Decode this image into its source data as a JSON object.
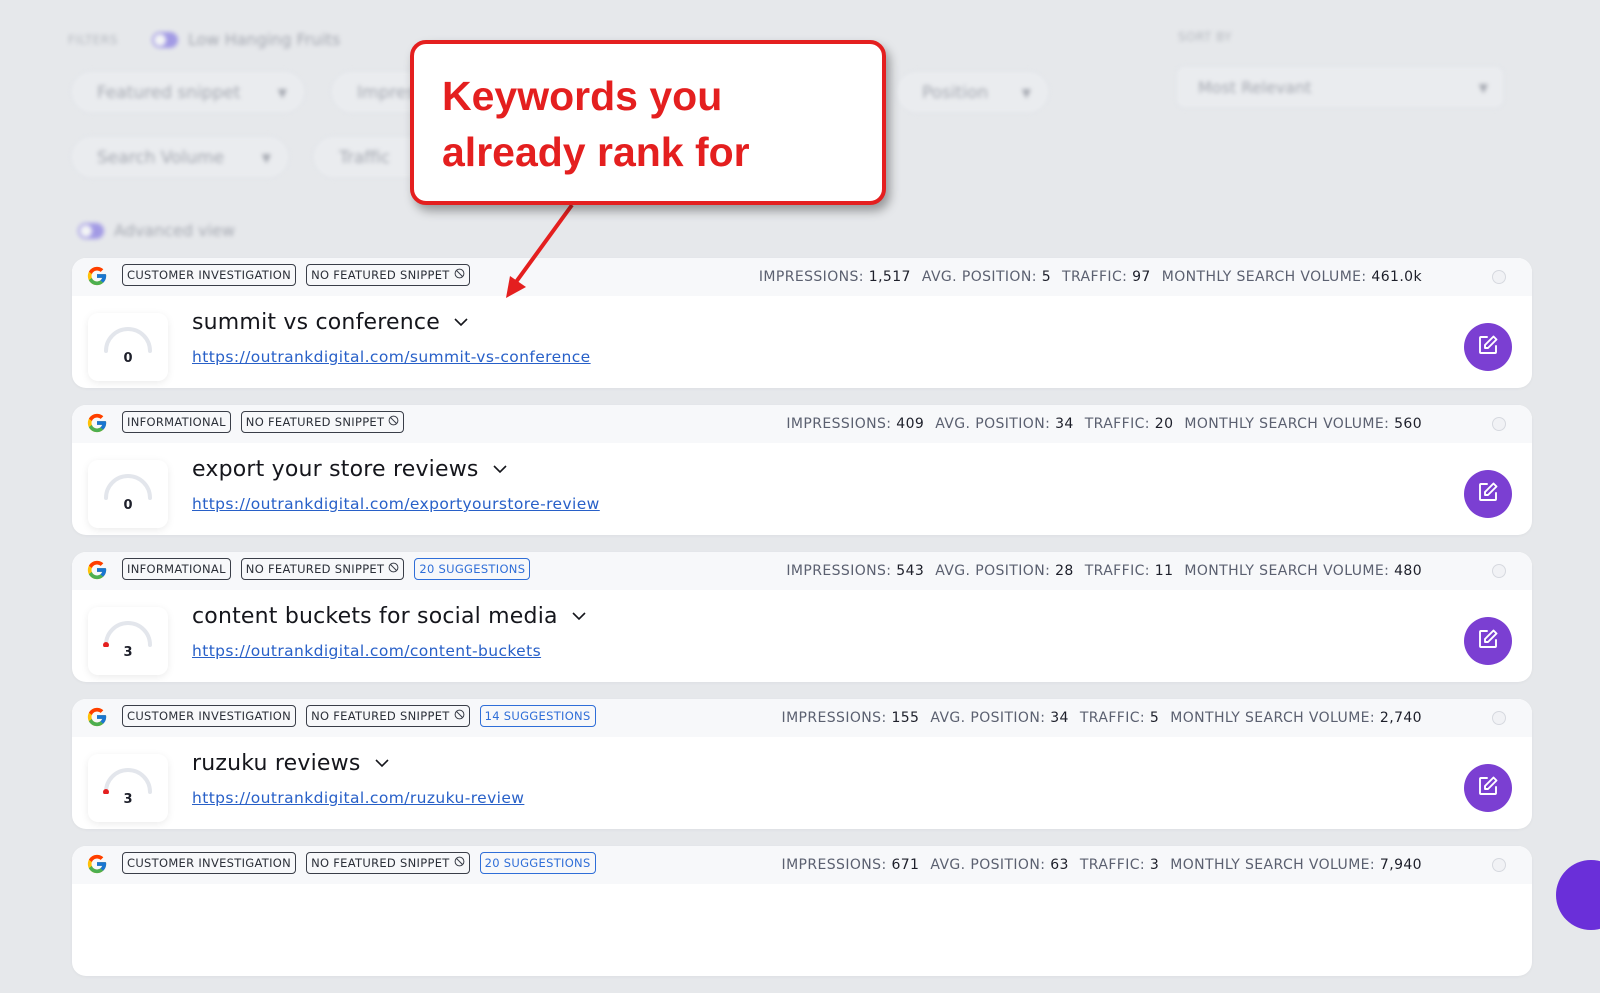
{
  "filters": {
    "filters_label": "FILTERS",
    "low_hanging_label": "Low Hanging Fruits",
    "pill_featured": "Featured snippet",
    "pill_impressions": "Impressions",
    "pill_position": "Position",
    "pill_search_volume": "Search Volume",
    "pill_traffic": "Traffic",
    "sort_label": "SORT BY",
    "sort_value": "Most Relevant",
    "advanced_view": "Advanced view"
  },
  "callout": {
    "text": "Keywords you already rank for"
  },
  "metric_labels": {
    "impressions": "IMPRESSIONS:",
    "avg_position": "AVG. POSITION:",
    "traffic": "TRAFFIC:",
    "monthly_search_volume": "MONTHLY SEARCH VOLUME:"
  },
  "no_snippet_label": "NO FEATURED SNIPPET",
  "colors": {
    "accent_purple": "#7b3fd2",
    "callout_red": "#e41f1f",
    "link_blue": "#2860c8",
    "suggestion_blue": "#2f6ed8"
  },
  "icons": {
    "engine": "google-icon",
    "edit": "edit-icon",
    "dropdown": "chevron-down-icon",
    "no_snippet": "ban-icon"
  },
  "keywords": [
    {
      "intent": "CUSTOMER INVESTIGATION",
      "suggestions": "",
      "impressions": "1,517",
      "avg_position": "5",
      "traffic": "97",
      "monthly_search_volume": "461.0k",
      "score": "0",
      "keyword": "summit vs conference",
      "url": "https://outrankdigital.com/summit-vs-conference"
    },
    {
      "intent": "INFORMATIONAL",
      "suggestions": "",
      "impressions": "409",
      "avg_position": "34",
      "traffic": "20",
      "monthly_search_volume": "560",
      "score": "0",
      "keyword": "export your store reviews",
      "url": "https://outrankdigital.com/exportyourstore-review"
    },
    {
      "intent": "INFORMATIONAL",
      "suggestions": "20 SUGGESTIONS",
      "impressions": "543",
      "avg_position": "28",
      "traffic": "11",
      "monthly_search_volume": "480",
      "score": "3",
      "keyword": "content buckets for social media",
      "url": "https://outrankdigital.com/content-buckets"
    },
    {
      "intent": "CUSTOMER INVESTIGATION",
      "suggestions": "14 SUGGESTIONS",
      "impressions": "155",
      "avg_position": "34",
      "traffic": "5",
      "monthly_search_volume": "2,740",
      "score": "3",
      "keyword": "ruzuku reviews",
      "url": "https://outrankdigital.com/ruzuku-review"
    },
    {
      "intent": "CUSTOMER INVESTIGATION",
      "suggestions": "20 SUGGESTIONS",
      "impressions": "671",
      "avg_position": "63",
      "traffic": "3",
      "monthly_search_volume": "7,940",
      "score": "",
      "keyword": "",
      "url": ""
    }
  ]
}
